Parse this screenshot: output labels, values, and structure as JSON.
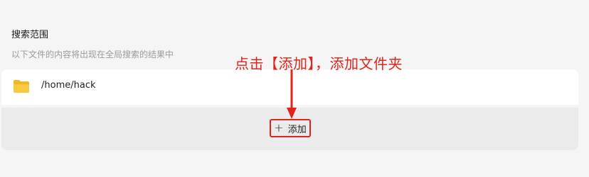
{
  "section": {
    "title": "搜索范围",
    "description": "以下文件的内容将出现在全局搜索的结果中"
  },
  "paths": [
    {
      "icon": "folder-icon",
      "path": "/home/hack"
    }
  ],
  "add_button": {
    "icon": "plus-icon",
    "label": "添加"
  },
  "annotation": {
    "text": "点击【添加】，添加文件夹",
    "color": "#e0241b"
  },
  "colors": {
    "folder": "#f5c518",
    "highlight": "#e0241b"
  }
}
